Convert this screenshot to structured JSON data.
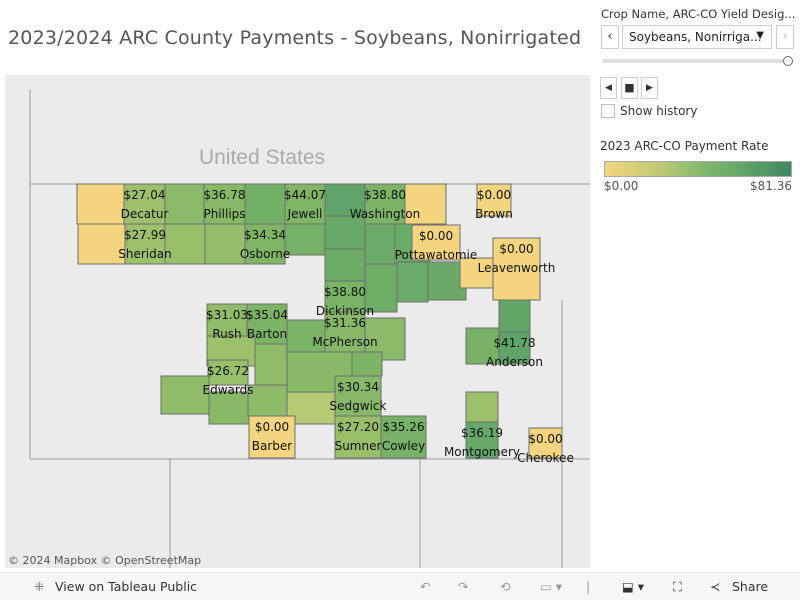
{
  "title": "2023/2024 ARC County Payments - Soybeans, Nonirrigated",
  "map": {
    "background_labels": [
      "United States"
    ],
    "attribution": "© 2024 Mapbox  © OpenStreetMap",
    "counties": [
      {
        "name": "Decatur",
        "value": "$27.04"
      },
      {
        "name": "Phillips",
        "value": "$36.78"
      },
      {
        "name": "Jewell",
        "value": "$44.07"
      },
      {
        "name": "Washington",
        "value": "$38.80"
      },
      {
        "name": "Brown",
        "value": "$0.00"
      },
      {
        "name": "Sheridan",
        "value": "$27.99"
      },
      {
        "name": "Osborne",
        "value": "$34.34"
      },
      {
        "name": "Pottawatomie",
        "value": "$0.00"
      },
      {
        "name": "Leavenworth",
        "value": "$0.00"
      },
      {
        "name": "Dickinson",
        "value": "$38.80"
      },
      {
        "name": "Rush",
        "value": "$31.03"
      },
      {
        "name": "Barton",
        "value": "$35.04"
      },
      {
        "name": "McPherson",
        "value": "$31.36"
      },
      {
        "name": "Anderson",
        "value": "$41.78"
      },
      {
        "name": "Edwards",
        "value": "$26.72"
      },
      {
        "name": "Sedgwick",
        "value": "$30.34"
      },
      {
        "name": "Barber",
        "value": "$0.00"
      },
      {
        "name": "Sumner",
        "value": "$27.20"
      },
      {
        "name": "Cowley",
        "value": "$35.26"
      },
      {
        "name": "Montgomery",
        "value": "$36.19"
      },
      {
        "name": "Cherokee",
        "value": "$0.00"
      }
    ]
  },
  "filter": {
    "label": "Crop Name, ARC-CO Yield Desig...",
    "selected": "Soybeans, Nonirriga...",
    "prev_icon": "chevron-left-icon",
    "next_icon": "chevron-right-icon"
  },
  "playback": {
    "show_history_label": "Show history",
    "show_history_checked": false,
    "slider_position": 1.0
  },
  "legend": {
    "title": "2023 ARC-CO Payment Rate",
    "min": "$0.00",
    "max": "$81.36",
    "color_low": "#f2d57e",
    "color_high": "#3e875e"
  },
  "footer": {
    "view_label": "View on Tableau Public",
    "share_label": "Share"
  }
}
